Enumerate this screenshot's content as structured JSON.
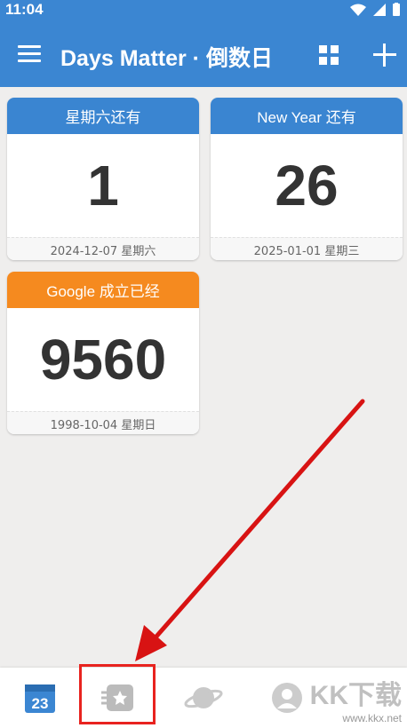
{
  "status_bar": {
    "time": "11:04"
  },
  "app_bar": {
    "title": "Days Matter · 倒数日"
  },
  "cards": [
    {
      "header": "星期六还有",
      "number": "1",
      "date": "2024-12-07 星期六",
      "color": "#3a85d1"
    },
    {
      "header": "New Year 还有",
      "number": "26",
      "date": "2025-01-01 星期三",
      "color": "#3a85d1"
    },
    {
      "header": "Google 成立已经",
      "number": "9560",
      "date": "1998-10-04 星期日",
      "color": "#f58a1f"
    }
  ],
  "bottom_nav": {
    "calendar_day": "23"
  },
  "watermark": {
    "text": "KK下载",
    "sub": "www.kkx.net"
  },
  "colors": {
    "accent": "#3b86d2",
    "orange": "#f58a1f",
    "annotation_red": "#e8231f"
  }
}
